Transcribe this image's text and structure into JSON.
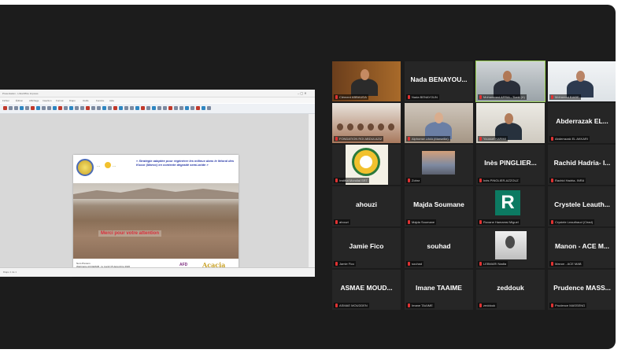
{
  "share": {
    "title": "Presentation - LibreOffice Impress",
    "menus": [
      "Fichier",
      "Édition",
      "Affichage",
      "Insertion",
      "Format",
      "Diapo",
      "Outils",
      "Fenêtre",
      "Aide"
    ],
    "status": "Diapo 1 de 1",
    "slide": {
      "head_title": "« Stratégie adaptée pour régénérer les milieux dans le littoral des Ksour (Maroc) en contexte dégradé semi-aride »",
      "caption": "Merci pour votre attention",
      "footer_line1": "Nom Prénom",
      "footer_line2": "Webinaire ACCEMAB - le mardi 15 décembre 2020",
      "logo1": "AFD",
      "logo2": "Acacia"
    }
  },
  "gallery": [
    {
      "id": "t1",
      "name": "",
      "label": "Clément ABBAUDA",
      "video": "man-bald"
    },
    {
      "id": "t2",
      "name": "Nada BENAYOU...",
      "label": "Nada BENAYOUN",
      "video": ""
    },
    {
      "id": "t3",
      "name": "",
      "label": "Mohammed AFRIA - Tiznit (A)",
      "video": "man-office",
      "active": true
    },
    {
      "id": "t4",
      "name": "",
      "label": "Mohamed BIABE",
      "video": "man-light"
    },
    {
      "id": "t5",
      "name": "",
      "label": "FONDATION ROI ABDULAZIZ",
      "video": "group"
    },
    {
      "id": "t6",
      "name": "",
      "label": "Alphonse LIMA (Marseille)",
      "video": "woman"
    },
    {
      "id": "t7",
      "name": "",
      "label": "Youssef KARIMI",
      "video": "man-glasses"
    },
    {
      "id": "t8",
      "name": "Abderrazak EL...",
      "label": "Abderrazak EL AKKARI",
      "video": ""
    },
    {
      "id": "t9",
      "name": "",
      "label": "Institut Mondial SRT",
      "video": "logo"
    },
    {
      "id": "t10",
      "name": "",
      "label": "Zohra",
      "video": "landscape"
    },
    {
      "id": "t11",
      "name": "Inès PINGLIER...",
      "label": "Inès PINGLIER-AZZOUZ",
      "video": ""
    },
    {
      "id": "t12",
      "name": "Rachid Hadria- I...",
      "label": "Rachid Hadria- INRA",
      "video": ""
    },
    {
      "id": "t13",
      "name": "ahouzi",
      "label": "ahouzi",
      "video": ""
    },
    {
      "id": "t14",
      "name": "Majda Soumane",
      "label": "Majda Soumane",
      "video": ""
    },
    {
      "id": "t15",
      "name": "",
      "label": "Roxane Hamamsi Miguel",
      "video": "R"
    },
    {
      "id": "t16",
      "name": "Crystele Leauth...",
      "label": "Crystele Leauthaud (Cirad)",
      "video": ""
    },
    {
      "id": "t17",
      "name": "Jamie Fico",
      "label": "Jamie Fico",
      "video": ""
    },
    {
      "id": "t18",
      "name": "souhad",
      "label": "souhad",
      "video": ""
    },
    {
      "id": "t19",
      "name": "",
      "label": "LEBMARI Nadia",
      "video": "portrait"
    },
    {
      "id": "t20",
      "name": "Manon - ACE M...",
      "label": "Manon - ACE MAB",
      "video": ""
    },
    {
      "id": "t21",
      "name": "ASMAE MOUD...",
      "label": "ASMAE MOUDDEN",
      "video": ""
    },
    {
      "id": "t22",
      "name": "Imane TAAIME",
      "label": "Imane TAAIME",
      "video": ""
    },
    {
      "id": "t23",
      "name": "zeddouk",
      "label": "zeddouk",
      "video": ""
    },
    {
      "id": "t24",
      "name": "Prudence MASS...",
      "label": "Prudence MASSENG",
      "video": ""
    }
  ],
  "colors": {
    "active_speaker": "#9bd454",
    "mic_muted": "#e03232",
    "avatar_R": "#0c7a62",
    "background": "#1c1c1c"
  }
}
